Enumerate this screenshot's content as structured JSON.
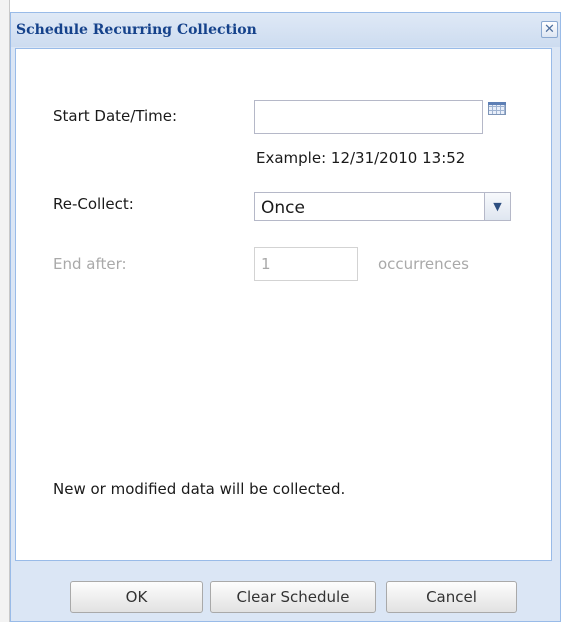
{
  "dialog": {
    "title": "Schedule Recurring Collection",
    "close_glyph": "✕"
  },
  "form": {
    "start_label": "Start Date/Time:",
    "start_value": "",
    "calendar_icon": "calendar-icon",
    "example_text": "Example: 12/31/2010 13:52",
    "recollect_label": "Re-Collect:",
    "recollect_value": "Once",
    "end_label": "End after:",
    "end_value": "1",
    "end_suffix": "occurrences",
    "info_text": "New or modified data will be collected."
  },
  "buttons": {
    "ok": "OK",
    "clear": "Clear Schedule",
    "cancel": "Cancel"
  },
  "colors": {
    "title_text": "#15428b",
    "frame": "#dbe6f5",
    "frame_border": "#99bbe8",
    "disabled_text": "#a9a9a9"
  }
}
